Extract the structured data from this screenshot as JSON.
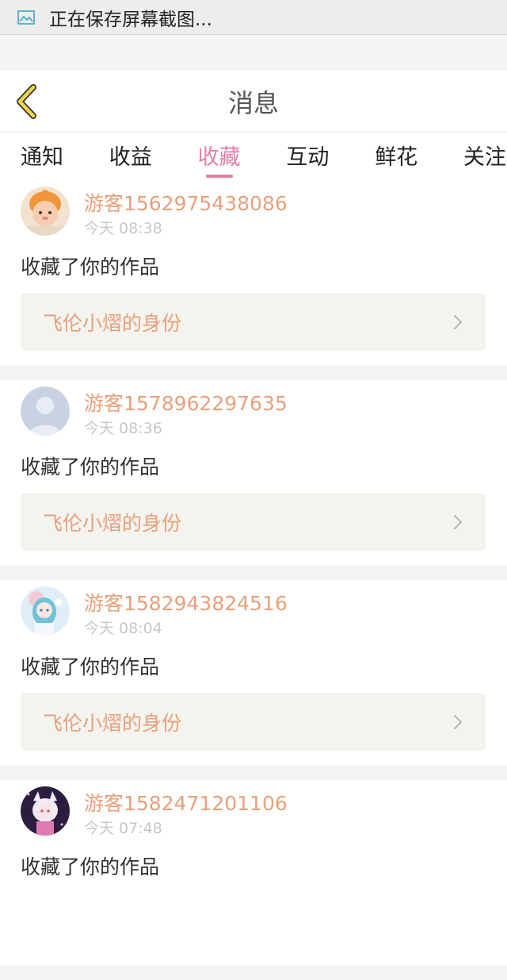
{
  "status_bar": {
    "text": "正在保存屏幕截图..."
  },
  "header": {
    "title": "消息"
  },
  "tabs": [
    {
      "label": "通知"
    },
    {
      "label": "收益"
    },
    {
      "label": "收藏"
    },
    {
      "label": "互动"
    },
    {
      "label": "鲜花"
    },
    {
      "label": "关注"
    }
  ],
  "active_tab": "收藏",
  "feed": [
    {
      "user": "游客1562975438086",
      "time": "今天 08:38",
      "action": "收藏了你的作品",
      "work": "飞伦小熠的身份"
    },
    {
      "user": "游客1578962297635",
      "time": "今天 08:36",
      "action": "收藏了你的作品",
      "work": "飞伦小熠的身份"
    },
    {
      "user": "游客1582943824516",
      "time": "今天 08:04",
      "action": "收藏了你的作品",
      "work": "飞伦小熠的身份"
    },
    {
      "user": "游客1582471201106",
      "time": "今天 07:48",
      "action": "收藏了你的作品",
      "work": ""
    }
  ],
  "colors": {
    "accent_pink": "#e37fa8",
    "name_orange": "#e8a07c",
    "back_yellow": "#f2d34a"
  }
}
